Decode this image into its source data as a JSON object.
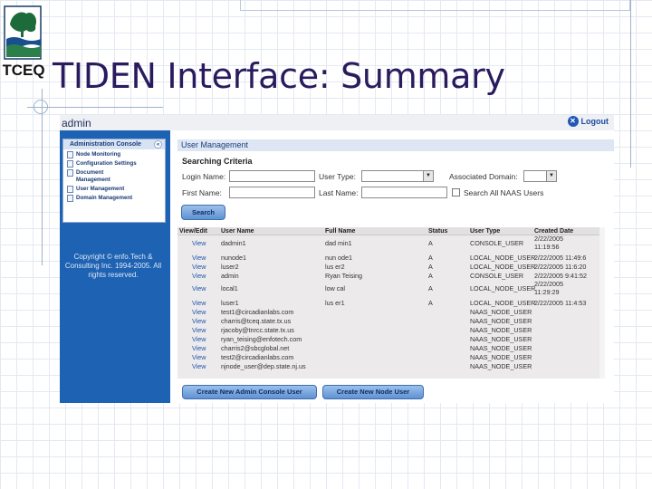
{
  "slide": {
    "title": "TIDEN Interface: Summary",
    "logo_text": "TCEQ"
  },
  "app": {
    "header_title": "admin",
    "logout_label": "Logout"
  },
  "sidebar": {
    "panel_title": "Administration Console",
    "items": [
      {
        "label": "Node Monitoring"
      },
      {
        "label": "Configuration Settings"
      },
      {
        "label": "Document Management"
      },
      {
        "label": "User Management"
      },
      {
        "label": "Domain Management"
      }
    ],
    "copyright": "Copyright © enfo.Tech & Consulting Inc. 1994-2005. All rights reserved."
  },
  "main": {
    "section_title": "User Management",
    "criteria_title": "Searching Criteria",
    "login_name_label": "Login Name:",
    "first_name_label": "First Name:",
    "user_type_label": "User Type:",
    "last_name_label": "Last Name:",
    "associated_domain_label": "Associated Domain:",
    "search_all_label": "Search All NAAS Users",
    "search_button": "Search",
    "create_admin_button": "Create New Admin Console User",
    "create_node_button": "Create New Node User"
  },
  "table": {
    "columns": [
      "View/Edit",
      "User Name",
      "Full Name",
      "Status",
      "User Type",
      "Created Date"
    ],
    "rows": [
      {
        "view": "View",
        "user": "dadmin1",
        "full": "dad min1",
        "status": "A",
        "type": "CONSOLE_USER",
        "date1": "2/22/2005",
        "date2": "11:19:56"
      },
      {
        "view": "View",
        "user": "nunode1",
        "full": "nun ode1",
        "status": "A",
        "type": "LOCAL_NODE_USER",
        "date1": "2/22/2005 11:49:6",
        "date2": ""
      },
      {
        "view": "View",
        "user": "luser2",
        "full": "lus er2",
        "status": "A",
        "type": "LOCAL_NODE_USER",
        "date1": "2/22/2005 11:6:20",
        "date2": ""
      },
      {
        "view": "View",
        "user": "admin",
        "full": "Ryan Teising",
        "status": "A",
        "type": "CONSOLE_USER",
        "date1": "2/22/2005 9:41:52",
        "date2": ""
      },
      {
        "view": "View",
        "user": "local1",
        "full": "low cal",
        "status": "A",
        "type": "LOCAL_NODE_USER",
        "date1": "2/22/2005",
        "date2": "11:29:29"
      },
      {
        "view": "View",
        "user": "luser1",
        "full": "lus er1",
        "status": "A",
        "type": "LOCAL_NODE_USER",
        "date1": "2/22/2005 11:4:53",
        "date2": ""
      },
      {
        "view": "View",
        "user": "test1@circadianlabs.com",
        "full": "",
        "status": "",
        "type": "NAAS_NODE_USER",
        "date1": "",
        "date2": ""
      },
      {
        "view": "View",
        "user": "charris@tceq.state.tx.us",
        "full": "",
        "status": "",
        "type": "NAAS_NODE_USER",
        "date1": "",
        "date2": ""
      },
      {
        "view": "View",
        "user": "rjacoby@tnrcc.state.tx.us",
        "full": "",
        "status": "",
        "type": "NAAS_NODE_USER",
        "date1": "",
        "date2": ""
      },
      {
        "view": "View",
        "user": "ryan_teising@enfotech.com",
        "full": "",
        "status": "",
        "type": "NAAS_NODE_USER",
        "date1": "",
        "date2": ""
      },
      {
        "view": "View",
        "user": "charris2@sbcglobal.net",
        "full": "",
        "status": "",
        "type": "NAAS_NODE_USER",
        "date1": "",
        "date2": ""
      },
      {
        "view": "View",
        "user": "test2@circadianlabs.com",
        "full": "",
        "status": "",
        "type": "NAAS_NODE_USER",
        "date1": "",
        "date2": ""
      },
      {
        "view": "View",
        "user": "njnode_user@dep.state.nj.us",
        "full": "",
        "status": "",
        "type": "NAAS_NODE_USER",
        "date1": "",
        "date2": ""
      }
    ]
  }
}
